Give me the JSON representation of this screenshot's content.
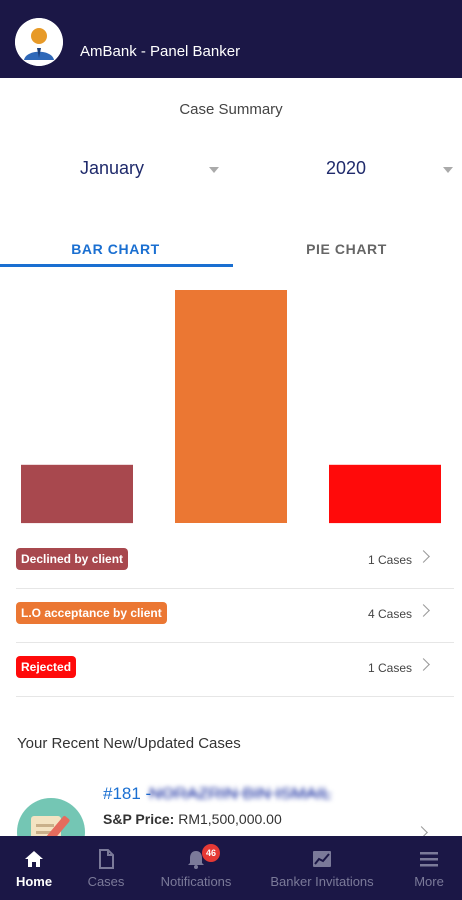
{
  "header": {
    "title": "AmBank - Panel Banker"
  },
  "summary": {
    "title": "Case Summary",
    "month": "January",
    "year": "2020"
  },
  "tabs": [
    {
      "label": "BAR CHART",
      "active": true
    },
    {
      "label": "PIE CHART",
      "active": false
    }
  ],
  "chart_data": {
    "type": "bar",
    "categories": [
      "Declined by client",
      "L.O acceptance by client",
      "Rejected"
    ],
    "values": [
      1,
      4,
      1
    ],
    "colors": [
      "#a8484e",
      "#eb7733",
      "#ff0a0a"
    ],
    "ylim": [
      0,
      4
    ]
  },
  "legend": [
    {
      "label": "Declined by client",
      "count": "1 Cases",
      "color": "#a8484e"
    },
    {
      "label": "L.O acceptance by client",
      "count": "4 Cases",
      "color": "#eb7733"
    },
    {
      "label": "Rejected",
      "count": "1 Cases",
      "color": "#ff0a0a"
    }
  ],
  "recent": {
    "title": "Your Recent New/Updated Cases",
    "items": [
      {
        "number": "#181 -",
        "name": "NORAZRIN BIN ISMAIL",
        "price_label": "S&P Price:",
        "price_value": "RM1,500,000.00"
      }
    ]
  },
  "nav": [
    {
      "label": "Home",
      "icon": "home-icon",
      "active": true
    },
    {
      "label": "Cases",
      "icon": "document-icon",
      "active": false
    },
    {
      "label": "Notifications",
      "icon": "bell-icon",
      "active": false,
      "badge": "46"
    },
    {
      "label": "Banker Invitations",
      "icon": "chart-icon",
      "active": false
    },
    {
      "label": "More",
      "icon": "menu-icon",
      "active": false
    }
  ],
  "colors": {
    "header_bg": "#1b1746",
    "accent": "#1a6fd1"
  }
}
